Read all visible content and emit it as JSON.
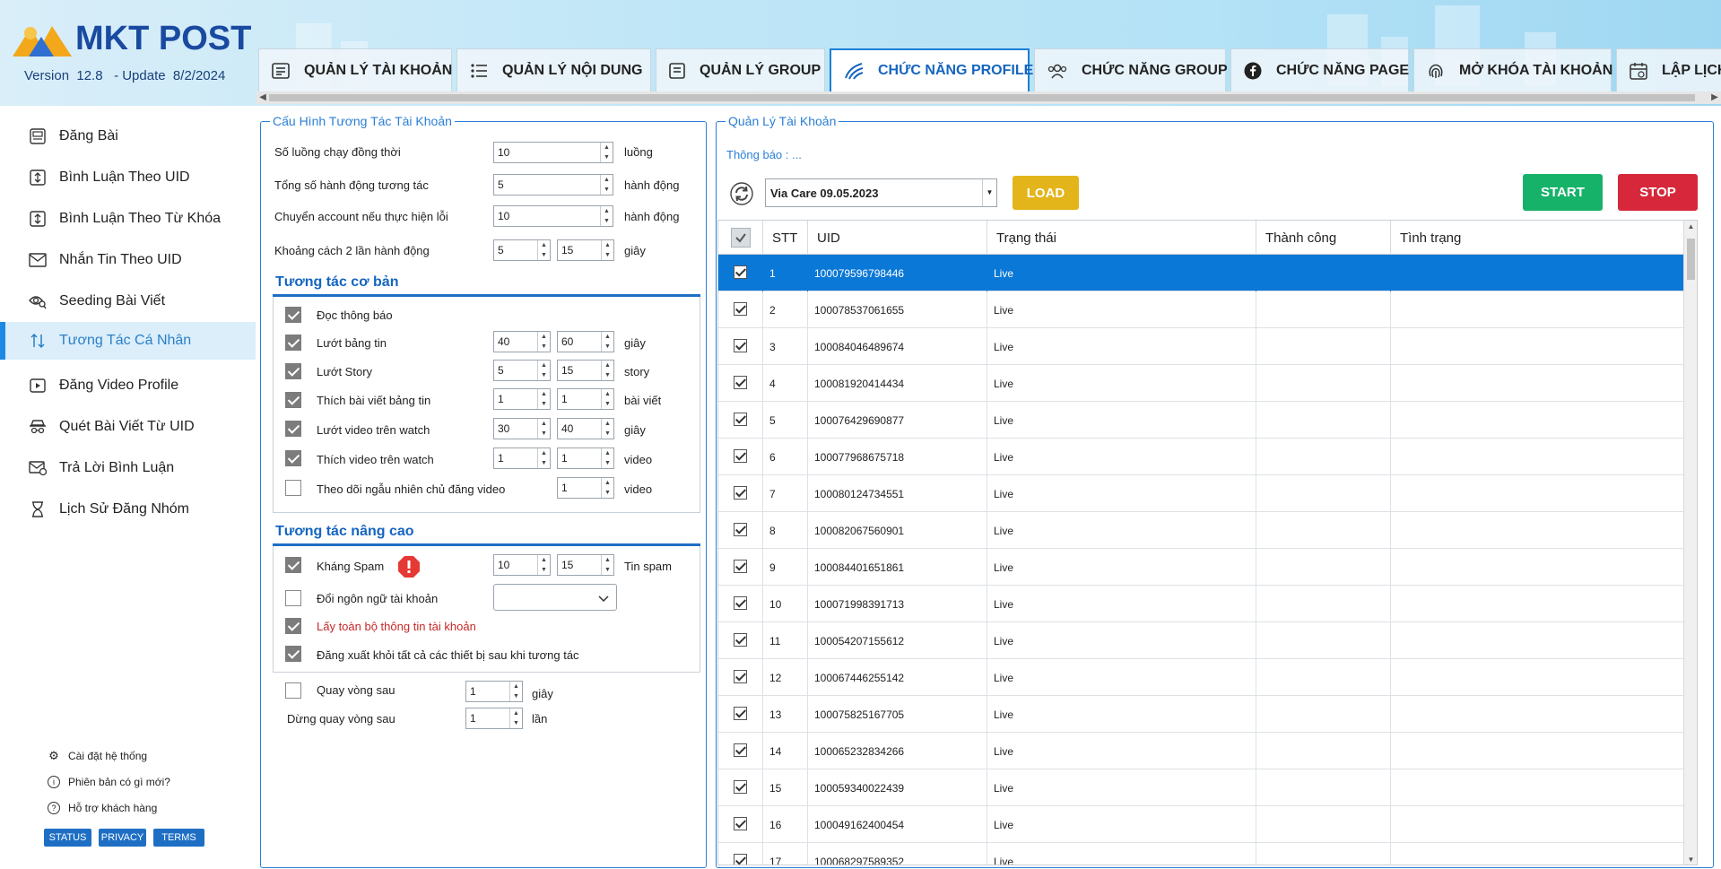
{
  "app": {
    "logo_text": "MKT POST",
    "version": "Version  12.8   - Update  8/2/2024"
  },
  "tabs": [
    {
      "label": "QUẢN LÝ TÀI KHOẢN",
      "icon": "account-list-icon"
    },
    {
      "label": "QUẢN LÝ NỘI DUNG",
      "icon": "content-list-icon"
    },
    {
      "label": "QUẢN LÝ GROUP",
      "icon": "group-doc-icon"
    },
    {
      "label": "CHỨC NĂNG PROFILE",
      "icon": "profile-wave-icon",
      "active": true
    },
    {
      "label": "CHỨC NĂNG GROUP",
      "icon": "people-icon"
    },
    {
      "label": "CHỨC NĂNG PAGE",
      "icon": "facebook-icon"
    },
    {
      "label": "MỞ KHÓA TÀI KHOẢN",
      "icon": "fingerprint-icon"
    },
    {
      "label": "LẬP LỊCH",
      "icon": "calendar-icon"
    }
  ],
  "sidebar": {
    "items": [
      {
        "label": "Đăng Bài"
      },
      {
        "label": "Bình Luận Theo UID"
      },
      {
        "label": "Bình Luận Theo Từ Khóa"
      },
      {
        "label": "Nhắn Tin Theo UID"
      },
      {
        "label": "Seeding Bài Viết"
      },
      {
        "label": "Tương Tác Cá Nhân",
        "active": true
      },
      {
        "label": "Đăng Video Profile"
      },
      {
        "label": "Quét Bài Viết Từ UID"
      },
      {
        "label": "Trả Lời Bình Luận"
      },
      {
        "label": "Lịch Sử Đăng Nhóm"
      }
    ],
    "footer_links": [
      "Cài đặt hệ thống",
      "Phiên bản có gì mới?",
      "Hỗ trợ khách hàng"
    ],
    "buttons": [
      "STATUS",
      "PRIVACY",
      "TERMS"
    ]
  },
  "config": {
    "title": "Cấu Hình Tương Tác Tài Khoản",
    "threads_label": "Số luồng chạy đồng thời",
    "threads_value": "10",
    "threads_unit": "luồng",
    "actions_label": "Tổng số hành động tương tác",
    "actions_value": "5",
    "actions_unit": "hành động",
    "switch_label": "Chuyển account nếu thực hiện lỗi",
    "switch_value": "10",
    "switch_unit": "hành động",
    "gap_label": "Khoảng cách 2 lần hành động",
    "gap_min": "5",
    "gap_max": "15",
    "gap_unit": "giây",
    "basic_title": "Tương tác cơ bản",
    "basic": [
      {
        "label": "Đọc thông báo",
        "checked": true
      },
      {
        "label": "Lướt bảng tin",
        "checked": true,
        "min": "40",
        "max": "60",
        "unit": "giây"
      },
      {
        "label": "Lướt Story",
        "checked": true,
        "min": "5",
        "max": "15",
        "unit": "story"
      },
      {
        "label": "Thích bài viết bảng tin",
        "checked": true,
        "min": "1",
        "max": "1",
        "unit": "bài viết"
      },
      {
        "label": "Lướt video trên watch",
        "checked": true,
        "min": "30",
        "max": "40",
        "unit": "giây"
      },
      {
        "label": "Thích video trên watch",
        "checked": true,
        "min": "1",
        "max": "1",
        "unit": "video"
      },
      {
        "label": "Theo dõi ngẫu nhiên chủ đăng video",
        "checked": false,
        "max": "1",
        "unit": "video"
      }
    ],
    "advanced_title": "Tương tác nâng cao",
    "spam_label": "Kháng Spam",
    "spam_min": "10",
    "spam_max": "15",
    "spam_unit": "Tin spam",
    "lang_label": "Đổi ngôn ngữ tài khoản",
    "lang_value": "",
    "fetch_label": "Lấy toàn bộ thông tin tài khoản",
    "logout_label": "Đăng xuất khỏi tất cả các thiết bị sau khi tương tác",
    "loop_label": "Quay vòng sau",
    "loop_value": "1",
    "loop_unit": "giây",
    "stop_loop_label": "Dừng quay vòng sau",
    "stop_loop_value": "1",
    "stop_loop_unit": "lần"
  },
  "manager": {
    "title": "Quản Lý Tài Khoản",
    "notice": "Thông báo : ...",
    "select_value": "Via Care 09.05.2023",
    "load_label": "LOAD",
    "start_label": "START",
    "stop_label": "STOP",
    "colors": {
      "load": "#e3b51b",
      "start": "#17b26a",
      "stop": "#d6283a",
      "selected_row": "#0a78d7"
    },
    "columns": [
      "STT",
      "UID",
      "Trạng thái",
      "Thành công",
      "Tình trạng"
    ],
    "rows": [
      {
        "stt": "1",
        "uid": "100079596798446",
        "status": "Live"
      },
      {
        "stt": "2",
        "uid": "100078537061655",
        "status": "Live"
      },
      {
        "stt": "3",
        "uid": "100084046489674",
        "status": "Live"
      },
      {
        "stt": "4",
        "uid": "100081920414434",
        "status": "Live"
      },
      {
        "stt": "5",
        "uid": "100076429690877",
        "status": "Live"
      },
      {
        "stt": "6",
        "uid": "100077968675718",
        "status": "Live"
      },
      {
        "stt": "7",
        "uid": "100080124734551",
        "status": "Live"
      },
      {
        "stt": "8",
        "uid": "100082067560901",
        "status": "Live"
      },
      {
        "stt": "9",
        "uid": "100084401651861",
        "status": "Live"
      },
      {
        "stt": "10",
        "uid": "100071998391713",
        "status": "Live"
      },
      {
        "stt": "11",
        "uid": "100054207155612",
        "status": "Live"
      },
      {
        "stt": "12",
        "uid": "100067446255142",
        "status": "Live"
      },
      {
        "stt": "13",
        "uid": "100075825167705",
        "status": "Live"
      },
      {
        "stt": "14",
        "uid": "100065232834266",
        "status": "Live"
      },
      {
        "stt": "15",
        "uid": "100059340022439",
        "status": "Live"
      },
      {
        "stt": "16",
        "uid": "100049162400454",
        "status": "Live"
      },
      {
        "stt": "17",
        "uid": "100068297589352",
        "status": "Live"
      }
    ]
  }
}
